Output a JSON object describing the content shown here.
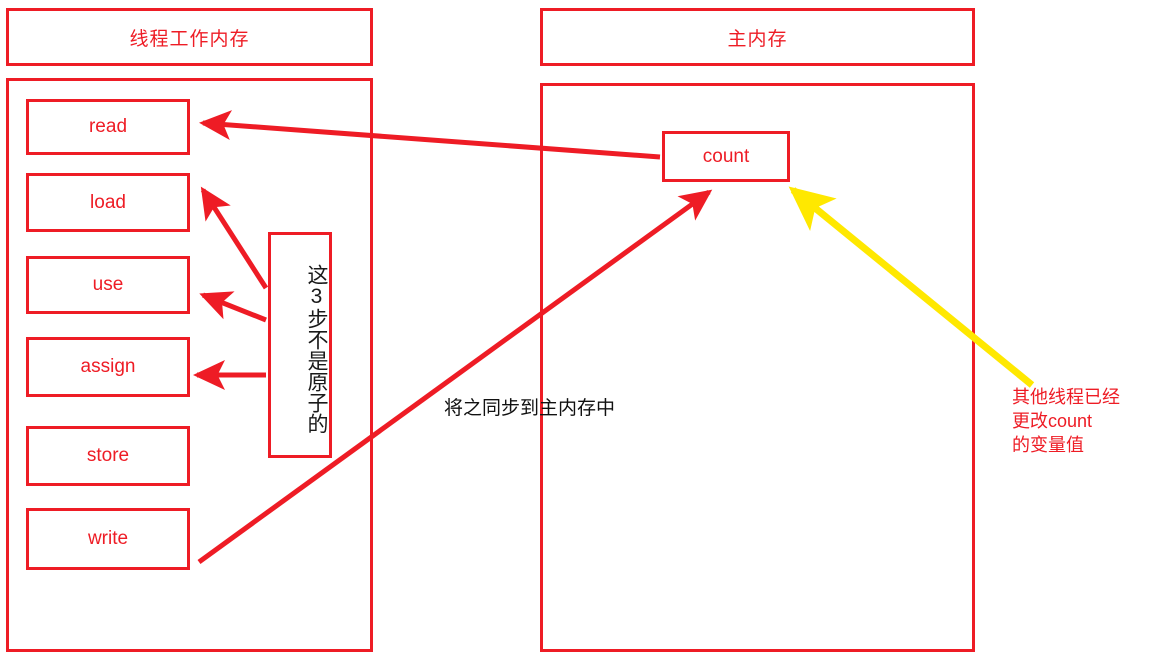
{
  "diagram": {
    "title_left": "线程工作内存",
    "title_right": "主内存",
    "left_panel": {
      "operations": [
        {
          "label": "read"
        },
        {
          "label": "load"
        },
        {
          "label": "use"
        },
        {
          "label": "assign"
        },
        {
          "label": "store"
        },
        {
          "label": "write"
        }
      ]
    },
    "right_panel": {
      "variable": "count"
    },
    "note_atomic": "这3步不是原子的",
    "callout_sync": "将之同步到主内存中",
    "callout_modified": {
      "line1": "其他线程已经",
      "line2": "更改count",
      "line3": "的变量值"
    },
    "colors": {
      "red": "#ee1c25",
      "yellow": "#ffe800",
      "black": "#111111",
      "background": "#ffffff"
    }
  }
}
